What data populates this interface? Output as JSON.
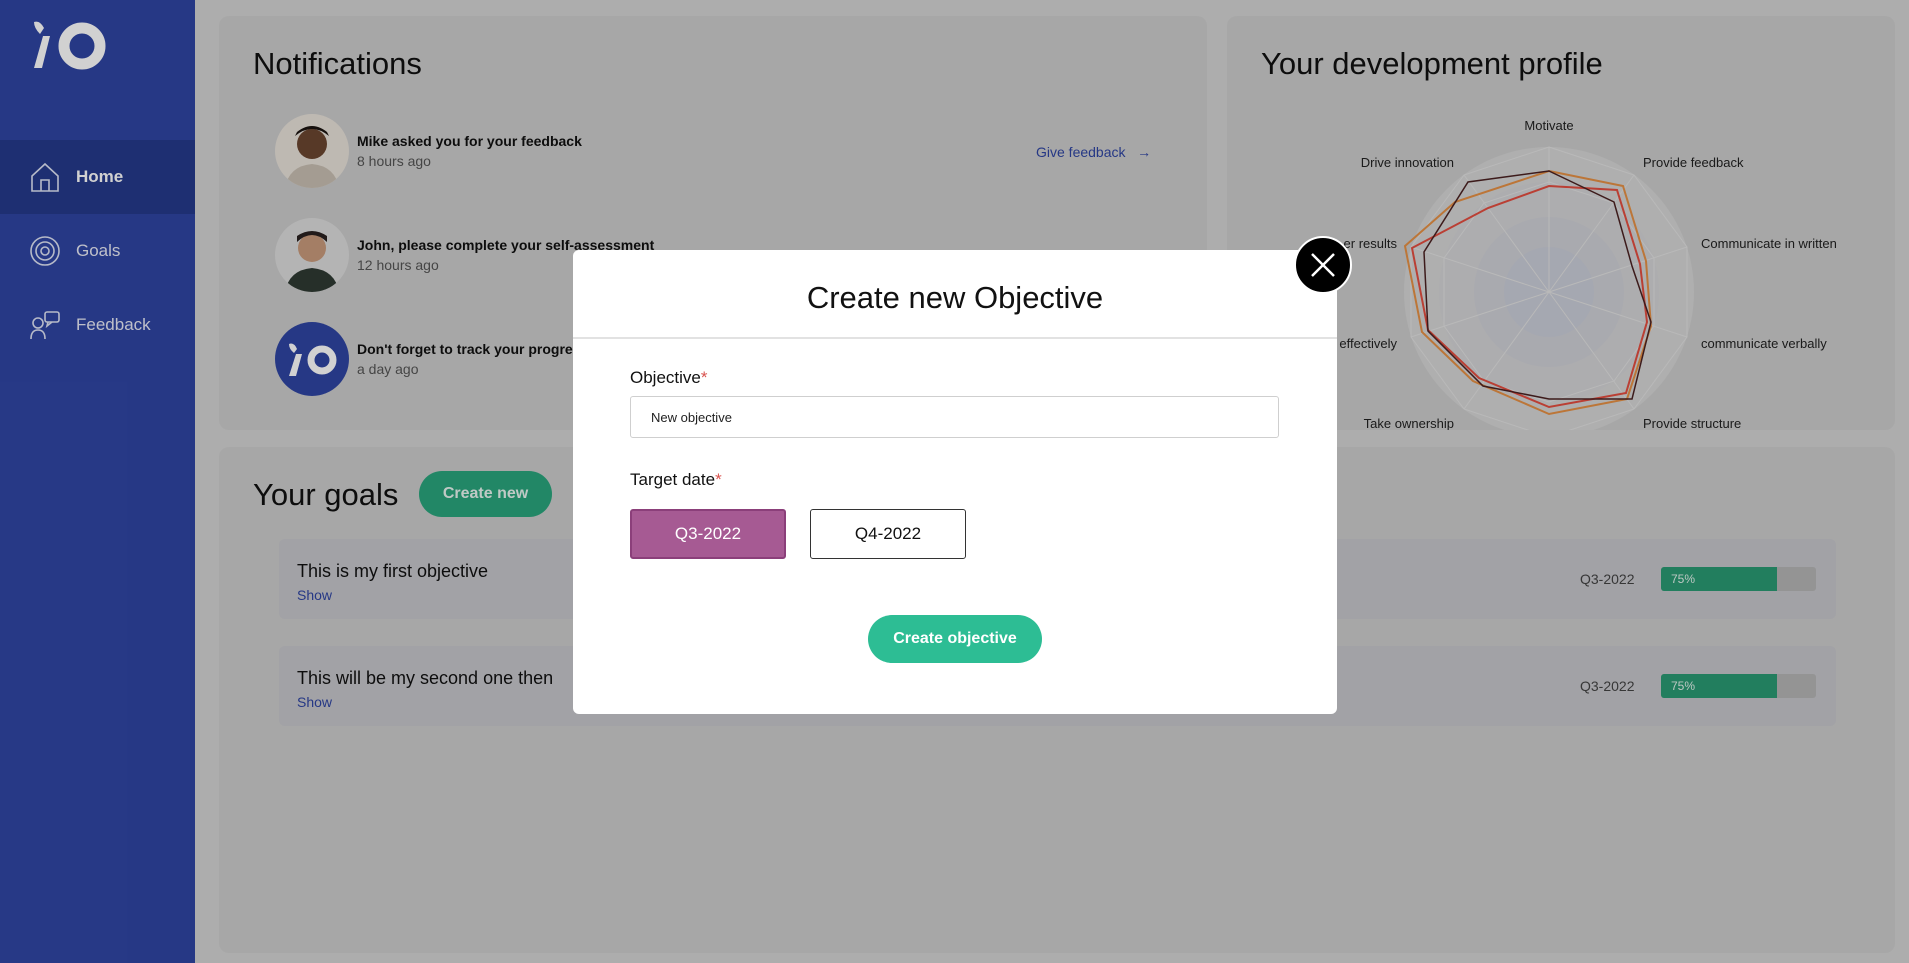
{
  "nav": {
    "items": [
      {
        "label": "Home",
        "active": true,
        "icon": "home-icon"
      },
      {
        "label": "Goals",
        "active": false,
        "icon": "target-icon"
      },
      {
        "label": "Feedback",
        "active": false,
        "icon": "feedback-icon"
      }
    ]
  },
  "notifications": {
    "title": "Notifications",
    "items": [
      {
        "text": "Mike asked you for your feedback",
        "time": "8 hours ago",
        "action": "Give feedback"
      },
      {
        "text": "John, please complete your self-assessment",
        "time": "12 hours ago"
      },
      {
        "text": "Don't forget to track your progress",
        "time": "a day ago"
      }
    ]
  },
  "development": {
    "title": "Your development profile",
    "labels": [
      "Motivate",
      "Provide feedback",
      "Communicate in written",
      "communicate verbally",
      "Provide structure",
      "",
      "Take ownership",
      "effectively",
      "er results",
      "Drive innovation"
    ]
  },
  "goals": {
    "title": "Your goals",
    "create_label": "Create new",
    "items": [
      {
        "name": "This is my first objective",
        "show": "Show",
        "date": "Q3-2022",
        "progress": 75,
        "progress_label": "75%"
      },
      {
        "name": "This will be my second one then",
        "show": "Show",
        "date": "Q3-2022",
        "progress": 75,
        "progress_label": "75%"
      }
    ]
  },
  "modal": {
    "title": "Create new Objective",
    "objective_label": "Objective",
    "required_mark": "*",
    "objective_value": "New objective",
    "target_label": "Target date",
    "option_selected": "Q3-2022",
    "option_other": "Q4-2022",
    "submit_label": "Create objective"
  },
  "colors": {
    "sidebar": "#2f45a3",
    "accent_green": "#2dbd94",
    "selected_purple": "#a65a93"
  }
}
